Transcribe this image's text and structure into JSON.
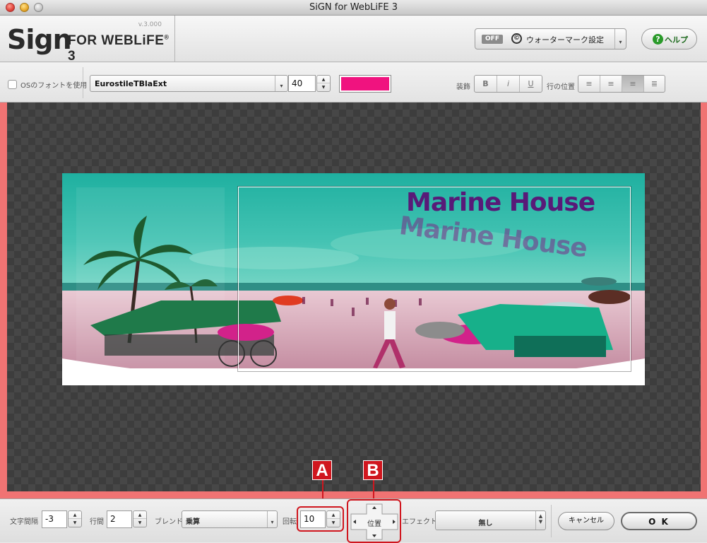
{
  "window": {
    "title": "SiGN for WebLiFE 3"
  },
  "header": {
    "logo_main": "Sign",
    "logo_rest": "FOR WEBLiFE",
    "logo_sup": "®",
    "logo_num": "3",
    "version": "v.3.000",
    "watermark": {
      "toggle": "OFF",
      "symbol": "©",
      "label": "ウォーターマーク設定"
    },
    "help_label": "ヘルプ",
    "help_symbol": "?"
  },
  "toolbar": {
    "os_font_label": "OSのフォントを使用",
    "font_name": "EurostileTBlaExt",
    "font_size": "40",
    "text_color": "#f0137f",
    "decoration_label": "装飾",
    "bold": "B",
    "italic": "i",
    "underline": "U",
    "line_position_label": "行の位置"
  },
  "canvas": {
    "headline": "Marine House",
    "shadow_text": "Marine House"
  },
  "bottom": {
    "letter_spacing_label": "文字間隔",
    "letter_spacing": "-3",
    "line_spacing_label": "行間",
    "line_spacing": "2",
    "blend_label": "ブレンド",
    "blend_value": "乗算",
    "rotation_label": "回転",
    "rotation": "10",
    "position_label": "位置",
    "effect_label": "エフェクト",
    "effect_value": "無し",
    "cancel_label": "キャンセル",
    "ok_label": "O K"
  },
  "callouts": {
    "a": "A",
    "b": "B"
  },
  "colors": {
    "accent_red": "#d0161e",
    "canvas_border": "#f07373",
    "text_color": "#f0137f"
  }
}
